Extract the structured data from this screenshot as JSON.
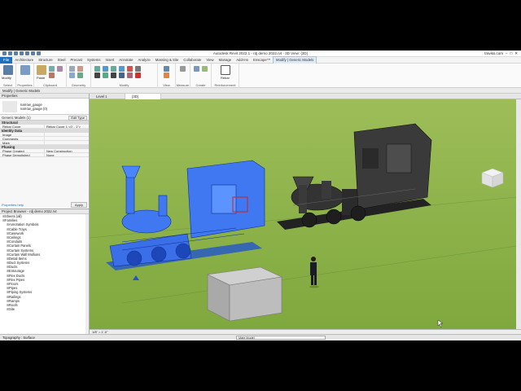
{
  "title": "Autodesk Revit 2022.1 - rdj demo 2022.rvt - 3D View: {3D}",
  "signin": "traviss.com",
  "menu": {
    "file": "File",
    "tabs": [
      "Architecture",
      "Structure",
      "Steel",
      "Precast",
      "Systems",
      "Insert",
      "Annotate",
      "Analyze",
      "Massing & Site",
      "Collaborate",
      "View",
      "Manage",
      "Add-Ins",
      "Enscape™",
      "Modify | Generic Models"
    ]
  },
  "ribbon": {
    "groups": [
      "Select",
      "Properties",
      "Clipboard",
      "Geometry",
      "Modify",
      "View",
      "Measure",
      "Create",
      "Reinforcement"
    ],
    "modify_label": "Modify",
    "paste_label": "Paste",
    "rebar_label": "Rebar"
  },
  "options_bar": "Modify | Generic Models",
  "properties": {
    "title": "Properties",
    "type_line1": "narrow_gauge",
    "type_line2": "narrow_gauge (0)",
    "filter": "Generic Models (1)",
    "edit_type": "Edit Type",
    "sections": [
      {
        "name": "Structural",
        "rows": [
          {
            "k": "Rebar Cover",
            "v": "Rebar Cover 1 <0' - 1\">"
          }
        ]
      },
      {
        "name": "Identity Data",
        "rows": [
          {
            "k": "Image",
            "v": ""
          },
          {
            "k": "Comments",
            "v": ""
          },
          {
            "k": "Mark",
            "v": ""
          }
        ]
      },
      {
        "name": "Phasing",
        "rows": [
          {
            "k": "Phase Created",
            "v": "New Construction"
          },
          {
            "k": "Phase Demolished",
            "v": "None"
          }
        ]
      }
    ],
    "help": "Properties help",
    "apply": "Apply"
  },
  "browser": {
    "title": "Project Browser - rdj demo 2022.rvt",
    "items": [
      {
        "label": "Sheets (all)",
        "level": 0
      },
      {
        "label": "Families",
        "level": 0
      },
      {
        "label": "Annotation Symbols",
        "level": 1
      },
      {
        "label": "Cable Trays",
        "level": 1
      },
      {
        "label": "Casework",
        "level": 1
      },
      {
        "label": "Ceilings",
        "level": 1
      },
      {
        "label": "Conduits",
        "level": 1
      },
      {
        "label": "Curtain Panels",
        "level": 1
      },
      {
        "label": "Curtain Systems",
        "level": 1
      },
      {
        "label": "Curtain Wall Mullions",
        "level": 1
      },
      {
        "label": "Detail Items",
        "level": 1
      },
      {
        "label": "Duct Systems",
        "level": 1
      },
      {
        "label": "Ducts",
        "level": 1
      },
      {
        "label": "Entourage",
        "level": 1
      },
      {
        "label": "Flex Ducts",
        "level": 1
      },
      {
        "label": "Flex Pipes",
        "level": 1
      },
      {
        "label": "Floors",
        "level": 1
      },
      {
        "label": "Pipes",
        "level": 1
      },
      {
        "label": "Piping Systems",
        "level": 1
      },
      {
        "label": "Railings",
        "level": 1
      },
      {
        "label": "Ramps",
        "level": 1
      },
      {
        "label": "Roofs",
        "level": 1
      },
      {
        "label": "Site",
        "level": 1
      }
    ]
  },
  "view_tabs": [
    "Level 1",
    "{3D}"
  ],
  "view_scale": "1/8\" = 1'-0\"",
  "status": {
    "left": "Topography : Surface",
    "main_model": "Main Model"
  }
}
